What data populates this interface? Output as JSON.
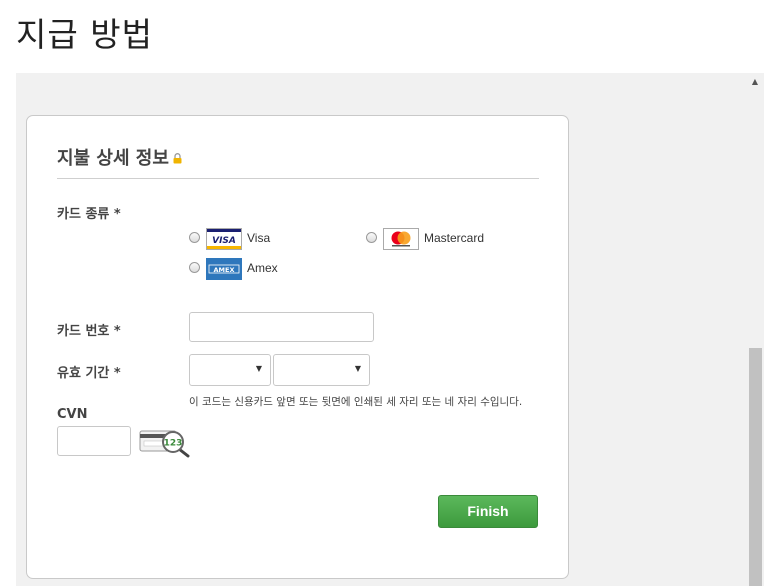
{
  "page": {
    "title": "지급 방법"
  },
  "card": {
    "title": "지불 상세 정보",
    "card_type": {
      "label": "카드 종류",
      "required_mark": "*",
      "options": [
        {
          "label": "Visa",
          "logo": "visa-logo",
          "logo_text": "VISA"
        },
        {
          "label": "Mastercard",
          "logo": "mastercard-logo"
        },
        {
          "label": "Amex",
          "logo": "amex-logo",
          "logo_text": "AMEX"
        }
      ]
    },
    "card_number": {
      "label": "카드 번호",
      "required_mark": "*",
      "value": ""
    },
    "expiry": {
      "label": "유효 기간",
      "required_mark": "*",
      "month_value": "",
      "year_value": ""
    },
    "cvn": {
      "label": "CVN",
      "value": "",
      "hint": "이 코드는 신용카드 앞면 또는 뒷면에 인쇄된 세 자리 또는 네 자리 수입니다.",
      "sample_digits": "123"
    },
    "finish_label": "Finish"
  },
  "colors": {
    "accent_green": "#4cae4c",
    "lock": "#f0b400",
    "visa_blue": "#1a1f71"
  },
  "icons": {
    "lock": "lock-icon",
    "cvn_help": "card-magnifier-icon",
    "scroll_up": "scroll-up-arrow-icon"
  }
}
